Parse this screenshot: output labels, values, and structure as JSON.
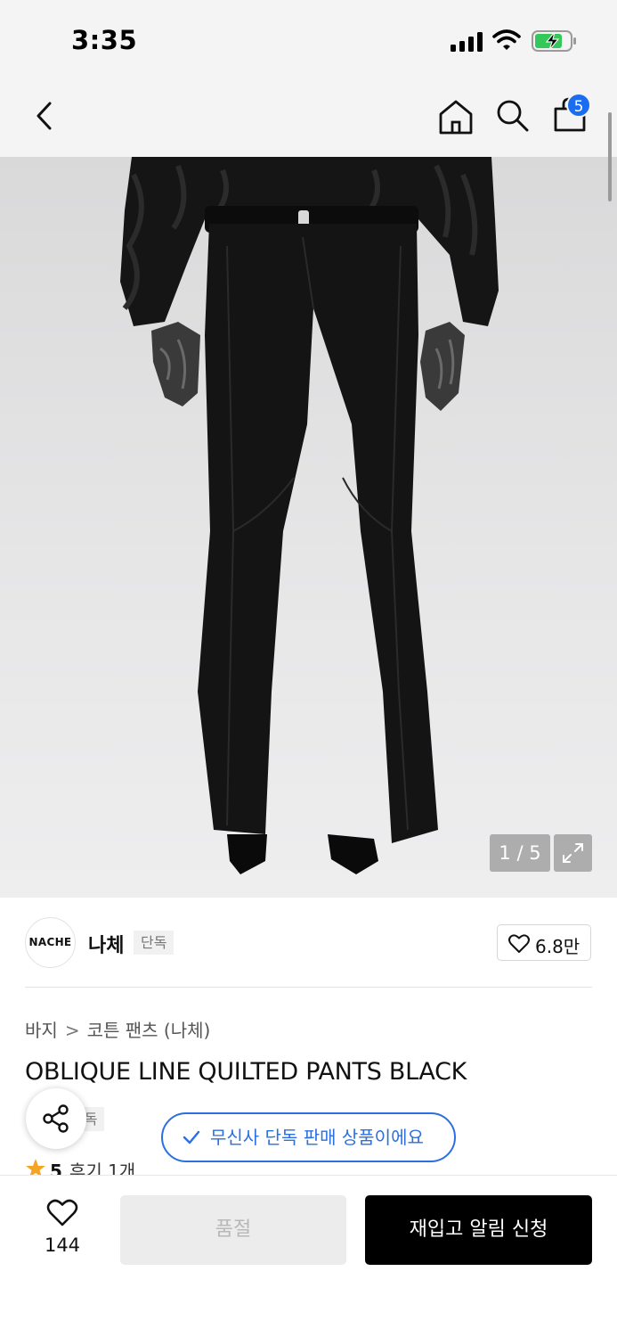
{
  "status_bar": {
    "time": "3:35"
  },
  "nav": {
    "cart_count": "5"
  },
  "gallery": {
    "counter": "1 / 5"
  },
  "brand": {
    "logo_text": "NACHE",
    "name": "나체",
    "tag": "단독",
    "likes": "6.8만"
  },
  "breadcrumb": {
    "category": "바지",
    "separator": ">",
    "subcategory": "코튼 팬츠 (나체)"
  },
  "product": {
    "title": "OBLIQUE LINE QUILTED PANTS BLACK",
    "tag": "단독",
    "exclusive_notice": "무신사 단독 판매 상품이에요",
    "rating": "5",
    "review_label": "후기 1개"
  },
  "bottom": {
    "wishlist_count": "144",
    "soldout_label": "품절",
    "restock_label": "재입고 알림 신청"
  },
  "colors": {
    "accent": "#2b6fe0",
    "badge": "#1a6cf0",
    "star": "#f5a524",
    "cta": "#000000"
  }
}
